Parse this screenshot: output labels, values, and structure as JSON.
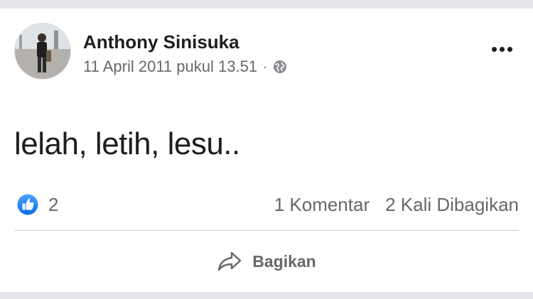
{
  "post": {
    "author": "Anthony Sinisuka",
    "timestamp": "11 April 2011 pukul 13.51",
    "separator": "·",
    "privacy_icon": "globe-icon",
    "more_icon": "more-options-icon",
    "text": "lelah, letih, lesu.."
  },
  "reactions": {
    "icon": "like-icon",
    "count": "2"
  },
  "stats": {
    "comments": "1 Komentar",
    "shares": "2 Kali Dibagikan"
  },
  "actions": {
    "share_icon": "share-icon",
    "share_label": "Bagikan"
  },
  "colors": {
    "like_blue": "#1877f2",
    "text_primary": "#1c1e21",
    "text_secondary": "#65676b",
    "divider": "#ced0d4",
    "background": "#e4e6eb"
  }
}
